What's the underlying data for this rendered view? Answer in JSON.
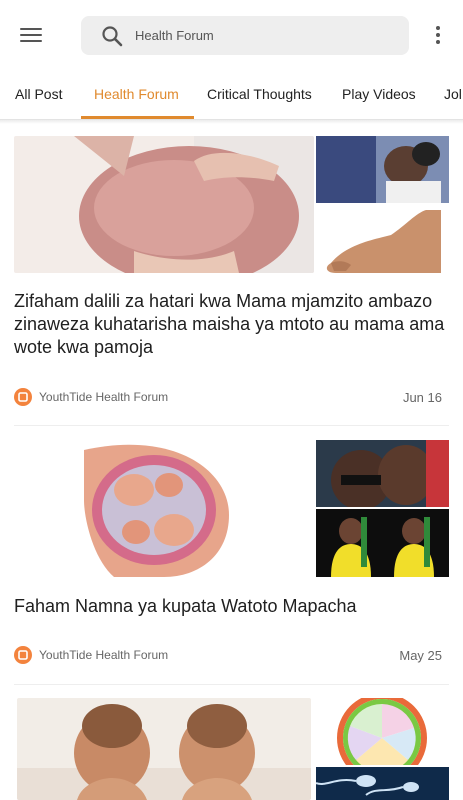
{
  "search": {
    "placeholder": "Health Forum"
  },
  "tabs": [
    {
      "label": "All Post"
    },
    {
      "label": "Health Forum"
    },
    {
      "label": "Critical Thoughts"
    },
    {
      "label": "Play Videos"
    },
    {
      "label": "Jol"
    }
  ],
  "active_tab": "Health Forum",
  "posts": [
    {
      "title": "Zifaham dalili za hatari kwa Mama mjamzito ambazo zinaweza kuhatarisha maisha ya mtoto au mama ama wote kwa pamoja",
      "source": "YouthTide Health Forum",
      "date": "Jun 16"
    },
    {
      "title": "Faham Namna ya kupata Watoto Mapacha",
      "source": "YouthTide Health Forum",
      "date": "May 25"
    },
    {
      "title": "",
      "source": "",
      "date": ""
    }
  ],
  "colors": {
    "accent": "#e08a2e",
    "source_icon": "#f3833d"
  }
}
